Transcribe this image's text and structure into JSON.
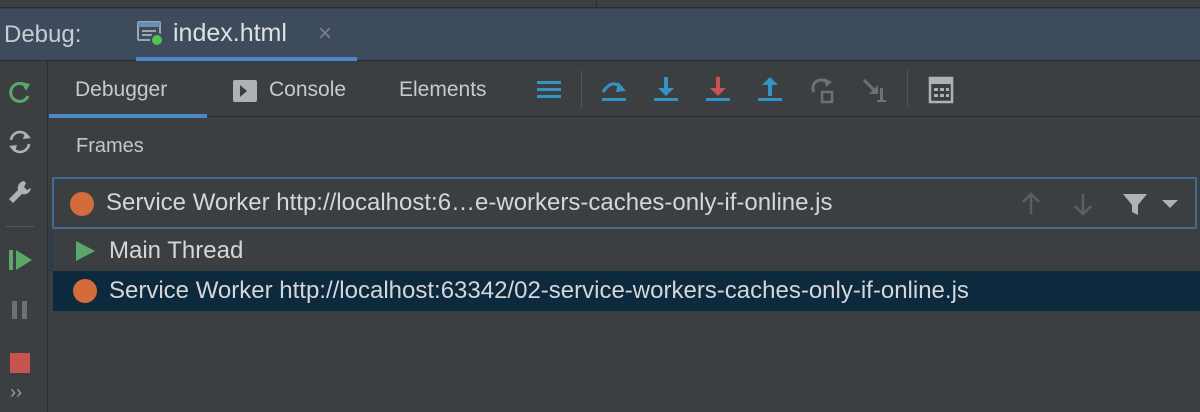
{
  "debug_header": {
    "label": "Debug:",
    "tab": {
      "title": "index.html",
      "close": "×",
      "icon": "html-debug-icon"
    }
  },
  "left_rail": {
    "buttons": [
      {
        "name": "rerun-icon",
        "color": "#59a869"
      },
      {
        "name": "refresh-icon",
        "color": "#afb1b3"
      },
      {
        "name": "wrench-icon",
        "color": "#afb1b3"
      },
      {
        "name": "resume-icon",
        "color": "#59a869"
      },
      {
        "name": "pause-icon",
        "color": "#6e7173"
      },
      {
        "name": "stop-icon",
        "color": "#c75450"
      }
    ],
    "more": "››"
  },
  "toolbar": {
    "tabs": [
      {
        "label": "Debugger",
        "active": true
      },
      {
        "label": "Console",
        "icon": "console-icon"
      },
      {
        "label": "Elements"
      }
    ],
    "actions": [
      "layout-menu-icon",
      "step-over-icon",
      "step-into-icon",
      "force-step-into-icon",
      "step-out-icon",
      "run-to-cursor-icon",
      "drop-frame-icon",
      "evaluate-expression-icon"
    ]
  },
  "frames": {
    "title": "Frames",
    "selected_thread": "Service Worker http://localhost:6…e-workers-caches-only-if-online.js",
    "threads": [
      {
        "label": "Main Thread",
        "icon": "play-icon"
      },
      {
        "label": "Service Worker http://localhost:63342/02-service-workers-caches-only-if-online.js",
        "icon": "service-worker-dot-icon",
        "selected": true
      }
    ]
  },
  "colors": {
    "accent": "#4a88c7",
    "header_bg": "#3d4b5c",
    "selection": "#0d293e",
    "worker_dot": "#d46b3b"
  }
}
